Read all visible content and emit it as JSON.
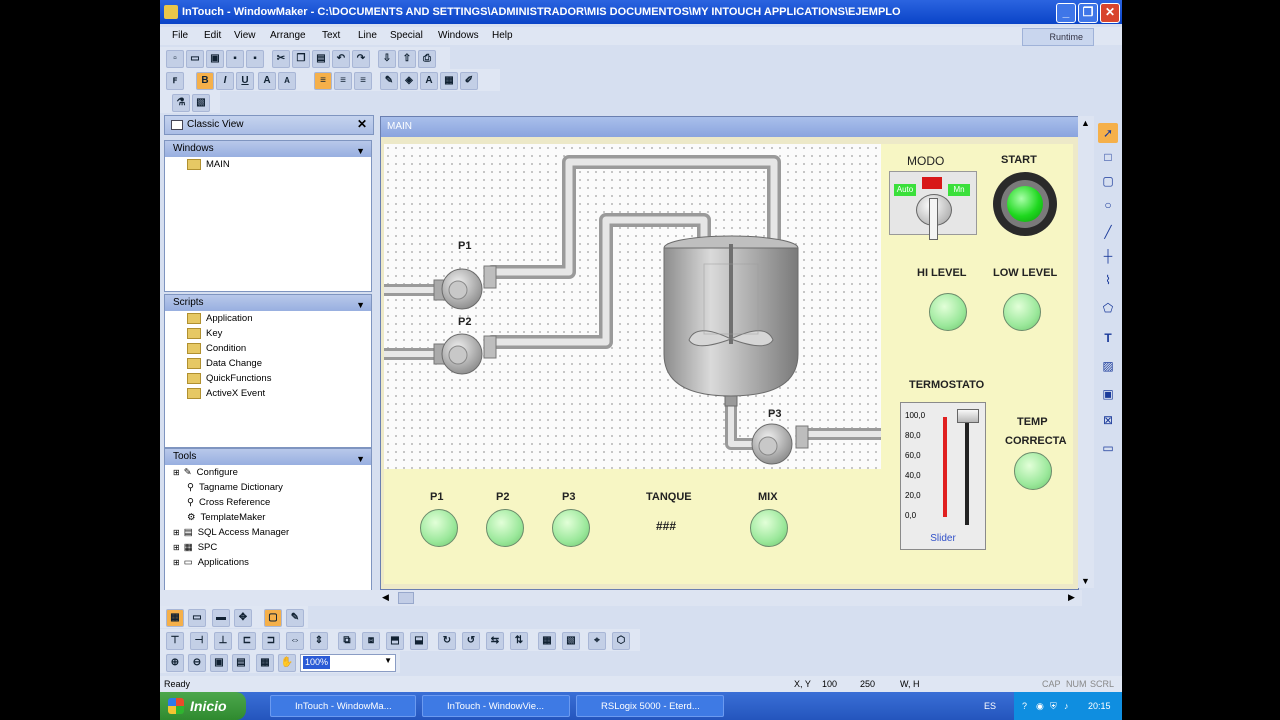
{
  "window": {
    "title": "InTouch - WindowMaker - C:\\DOCUMENTS AND SETTINGS\\ADMINISTRADOR\\MIS DOCUMENTOS\\MY INTOUCH APPLICATIONS\\EJEMPLO",
    "minimize": "_",
    "maximize": "❐",
    "close": "✕"
  },
  "menu": {
    "items": [
      "File",
      "Edit",
      "View",
      "Arrange",
      "Text",
      "Line",
      "Special",
      "Windows",
      "Help"
    ],
    "runtime": "Runtime"
  },
  "toolbar": {
    "bold": "B",
    "italic": "I",
    "underline": "U",
    "font_up": "A",
    "font_down": "A",
    "text_color": "A"
  },
  "left_panel": {
    "title": "Classic View",
    "close": "✕",
    "windows": {
      "header": "Windows",
      "items": [
        "MAIN"
      ]
    },
    "scripts": {
      "header": "Scripts",
      "items": [
        "Application",
        "Key",
        "Condition",
        "Data Change",
        "QuickFunctions",
        "ActiveX Event"
      ]
    },
    "tools": {
      "header": "Tools",
      "items": [
        "Configure",
        "Tagname Dictionary",
        "Cross Reference",
        "TemplateMaker",
        "SQL Access Manager",
        "SPC",
        "Applications"
      ]
    }
  },
  "canvas": {
    "window_title": "MAIN",
    "pump_labels": [
      "P1",
      "P2",
      "P3"
    ],
    "modo_label": "MODO",
    "modo_auto": "Auto",
    "modo_man": "Mn",
    "start_label": "START",
    "hi_level_label": "HI LEVEL",
    "low_level_label": "LOW LEVEL",
    "termostato_label": "TERMOSTATO",
    "slider_ticks": [
      "100,0",
      "80,0",
      "60,0",
      "40,0",
      "20,0",
      "0,0"
    ],
    "slider_caption": "Slider",
    "temp_label_1": "TEMP",
    "temp_label_2": "CORRECTA",
    "bottom_labels": [
      "P1",
      "P2",
      "P3"
    ],
    "tanque_label": "TANQUE",
    "tanque_value": "###",
    "mix_label": "MIX"
  },
  "bottom_tools": {
    "zoom_value": "100%"
  },
  "status": {
    "ready": "Ready",
    "xy_label": "X, Y",
    "x": "100",
    "y": "250",
    "wh_label": "W, H",
    "caps": "CAP",
    "num": "NUM",
    "scrl": "SCRL"
  },
  "taskbar": {
    "start": "Inicio",
    "tasks": [
      "InTouch - WindowMa...",
      "InTouch - WindowVie...",
      "RSLogix 5000 - Eterd..."
    ],
    "lang": "ES",
    "clock": "20:15"
  },
  "colors": {
    "start_lamp": "#1fd81f",
    "lamp_off": "#9be89b",
    "panel_yellow": "#f7f6c4",
    "titlebar": "#0a44c8",
    "slider_red": "#e02020"
  }
}
